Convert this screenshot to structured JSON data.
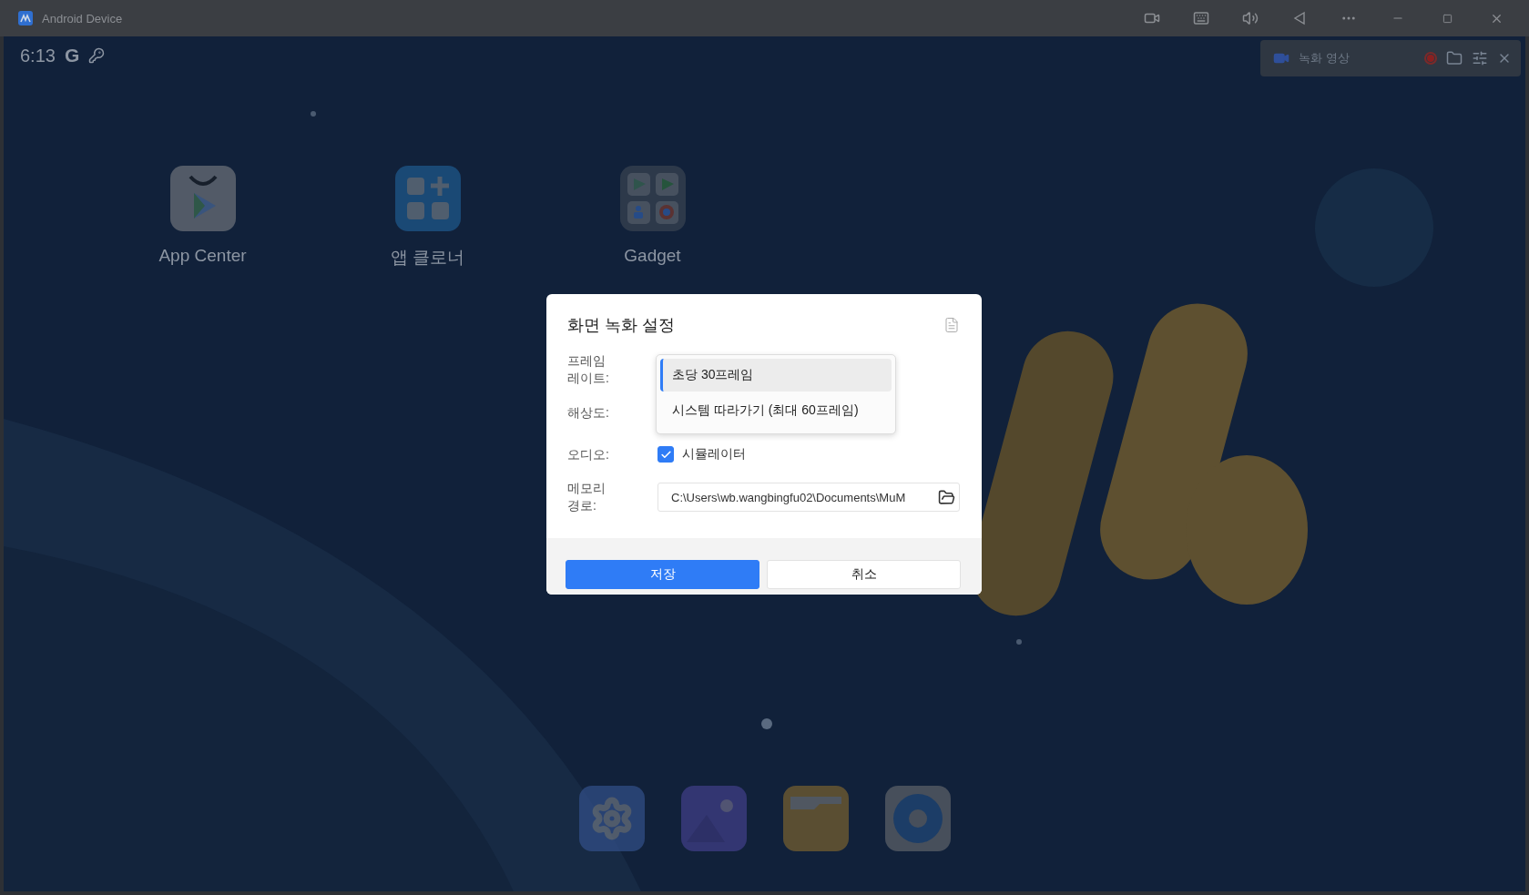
{
  "window": {
    "title": "Android Device"
  },
  "status_bar": {
    "time": "6:13",
    "account_mark": "G"
  },
  "recording_bar": {
    "label": "녹화 영상"
  },
  "desktop_apps": [
    {
      "label": "App Center",
      "kind": "store"
    },
    {
      "label": "앱 클로너",
      "kind": "cloner"
    },
    {
      "label": "Gadget",
      "kind": "folder"
    }
  ],
  "dock": [
    {
      "kind": "settings"
    },
    {
      "kind": "gallery"
    },
    {
      "kind": "files"
    },
    {
      "kind": "disc"
    }
  ],
  "dialog": {
    "title": "화면 녹화 설정",
    "fields": [
      {
        "kind": "select",
        "label": "프레임 레이트:"
      },
      {
        "kind": "covered",
        "label": "해상도:"
      },
      {
        "kind": "checkbox",
        "label": "오디오:",
        "option": "시뮬레이터",
        "checked": true
      },
      {
        "kind": "path",
        "label": "메모리 경로:",
        "value": "C:\\Users\\wb.wangbingfu02\\Documents\\MuM"
      }
    ],
    "dropdown": {
      "options": [
        {
          "label": "초당 30프레임",
          "selected": true
        },
        {
          "label": "시스템 따라가기 (최대 60프레임)",
          "selected": false
        }
      ]
    },
    "buttons": [
      {
        "label": "저장",
        "kind": "primary"
      },
      {
        "label": "취소",
        "kind": "secondary"
      }
    ]
  }
}
